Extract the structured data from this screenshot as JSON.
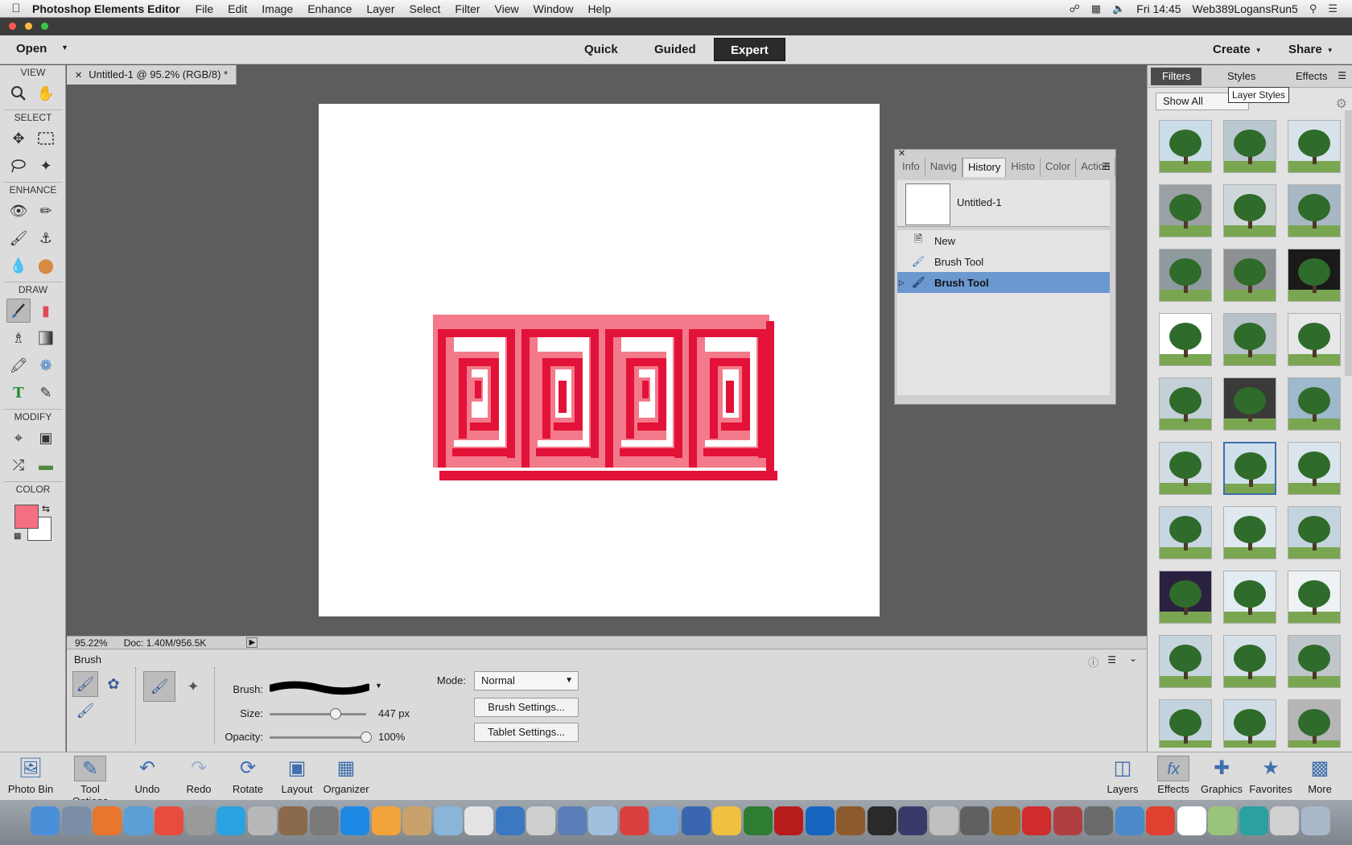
{
  "menubar": {
    "app_name": "Photoshop Elements Editor",
    "menus": [
      "File",
      "Edit",
      "Image",
      "Enhance",
      "Layer",
      "Select",
      "Filter",
      "View",
      "Window",
      "Help"
    ],
    "clock": "Fri 14:45",
    "user": "Web389LogansRun5"
  },
  "appbar": {
    "open_label": "Open",
    "modes": [
      "Quick",
      "Guided",
      "Expert"
    ],
    "active_mode": "Expert",
    "create_label": "Create",
    "share_label": "Share"
  },
  "toolbox": {
    "sections": [
      "VIEW",
      "SELECT",
      "ENHANCE",
      "DRAW",
      "MODIFY",
      "COLOR"
    ],
    "foreground_color": "#f56f80",
    "background_color": "#ffffff"
  },
  "document": {
    "tab_title": "Untitled-1 @ 95.2% (RGB/8) *",
    "zoom": "95.22%",
    "doc_size": "Doc: 1.40M/956.5K",
    "art_colors": {
      "light": "#f27a8a",
      "dark": "#e31238"
    }
  },
  "history_panel": {
    "tabs": [
      "Info",
      "Navig",
      "History",
      "Histo",
      "Color",
      "Action"
    ],
    "active_tab": "History",
    "snapshot_name": "Untitled-1",
    "items": [
      {
        "label": "New",
        "icon": "document-icon"
      },
      {
        "label": "Brush Tool",
        "icon": "brush-icon"
      },
      {
        "label": "Brush Tool",
        "icon": "brush-icon"
      }
    ],
    "selected_index": 2
  },
  "right_panel": {
    "tabs": [
      "Filters",
      "Styles",
      "Effects"
    ],
    "active_tab": "Filters",
    "filter_dropdown": "Show All",
    "tooltip": "Layer Styles"
  },
  "tool_options": {
    "title": "Brush",
    "brush_label": "Brush:",
    "size_label": "Size:",
    "size_value": "447 px",
    "size_level": 0.68,
    "opacity_label": "Opacity:",
    "opacity_value": "100%",
    "opacity_level": 1.0,
    "mode_label": "Mode:",
    "mode_value": "Normal",
    "brush_settings_label": "Brush Settings...",
    "tablet_settings_label": "Tablet Settings..."
  },
  "bottom_bar": {
    "left": [
      "Photo Bin",
      "Tool Options",
      "Undo",
      "Redo",
      "Rotate",
      "Layout",
      "Organizer"
    ],
    "right": [
      "Layers",
      "Effects",
      "Graphics",
      "Favorites",
      "More"
    ]
  }
}
